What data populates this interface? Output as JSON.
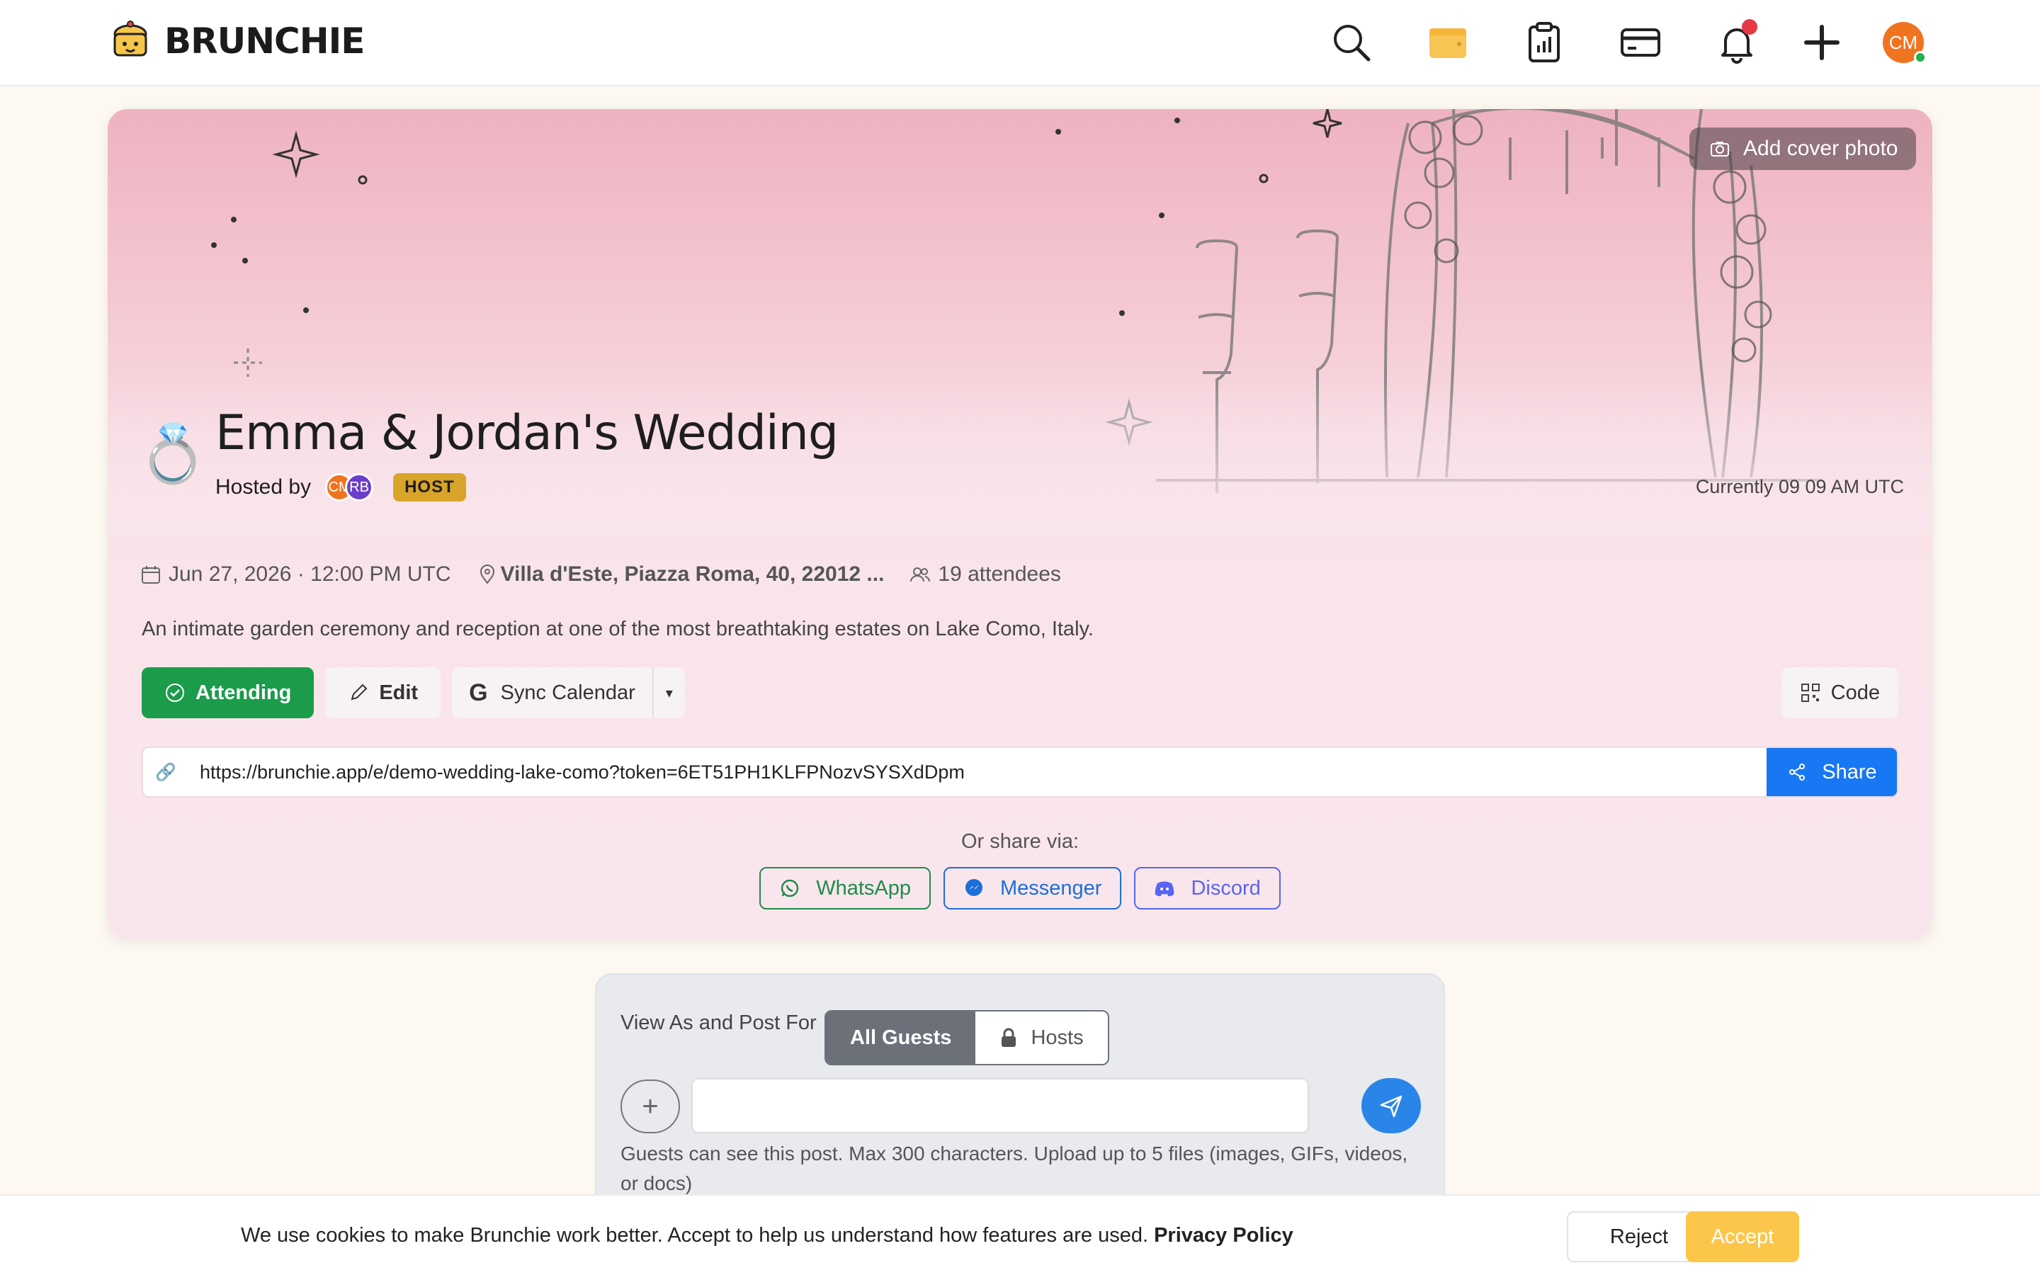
{
  "brand": {
    "name": "BRUNCHIE"
  },
  "nav": {
    "icons": [
      "search-icon",
      "wallet-icon",
      "clipboard-chart-icon",
      "credit-card-icon",
      "bell-icon",
      "plus-icon"
    ],
    "avatar_initials": "CM",
    "has_notification": true
  },
  "event": {
    "cover_button": "Add cover photo",
    "emoji": "💍",
    "title": "Emma & Jordan's Wedding",
    "hosted_by_label": "Hosted by",
    "hosts": [
      "CM",
      "RB"
    ],
    "host_badge": "HOST",
    "current_time": "Currently 09 09 AM UTC",
    "date": "Jun 27, 2026 · 12:00 PM UTC",
    "location": "Villa d'Este, Piazza Roma, 40, 22012 ...",
    "attendees": "19 attendees",
    "description": "An intimate garden ceremony and reception at one of the most breathtaking estates on Lake Como, Italy."
  },
  "actions": {
    "attending": "Attending",
    "edit": "Edit",
    "sync_calendar": "Sync Calendar",
    "code": "Code"
  },
  "share": {
    "url": "https://brunchie.app/e/demo-wedding-lake-como?token=6ET51PH1KLFPNozvSYSXdDpm",
    "share_label": "Share",
    "or_share_via": "Or share via:",
    "whatsapp": "WhatsApp",
    "messenger": "Messenger",
    "discord": "Discord"
  },
  "composer": {
    "view_as_label": "View As and Post For",
    "all_guests": "All Guests",
    "hosts": "Hosts",
    "input_value": "",
    "hint": "Guests can see this post.  Max 300 characters. Upload up to 5 files (images, GIFs, videos, or docs)"
  },
  "cookie": {
    "text": "We use cookies to make Brunchie work better. Accept to help us understand how features are used.",
    "policy_link": "Privacy Policy",
    "reject": "Reject",
    "accept": "Accept"
  },
  "colors": {
    "brand_green": "#1a9c4a",
    "share_blue": "#1877f2",
    "host_badge": "#d9a42a",
    "accept_yellow": "#fbc64a",
    "avatar_orange": "#f0731e",
    "avatar_purple": "#6b3fc9"
  }
}
